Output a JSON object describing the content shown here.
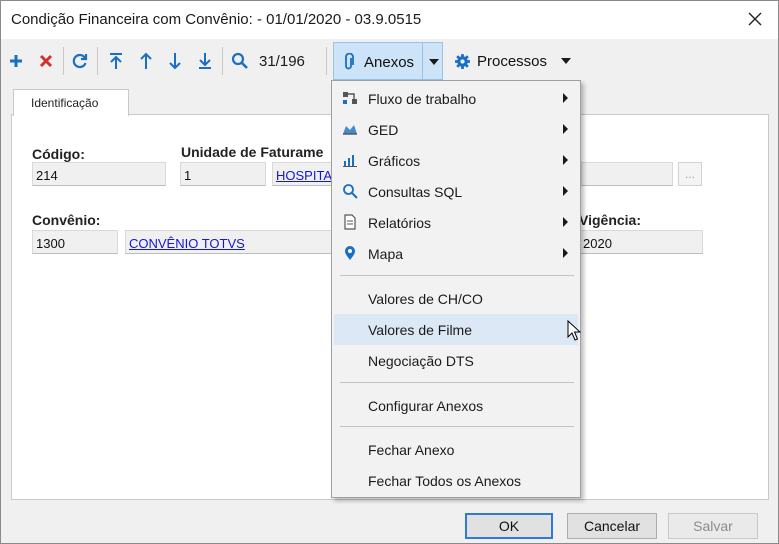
{
  "window": {
    "title": "Condição Financeira com Convênio:  - 01/01/2020 - 03.9.0515"
  },
  "toolbar": {
    "counter": "31/196",
    "anexos_label": "Anexos",
    "processos_label": "Processos",
    "icons": [
      "plus-icon",
      "delete-x-icon",
      "refresh-icon",
      "first-record-icon",
      "previous-record-icon",
      "next-record-icon",
      "last-record-icon",
      "search-icon",
      "paperclip-icon",
      "gear-icon",
      "chevron-down-icon"
    ]
  },
  "tab": {
    "label": "Identificação"
  },
  "form": {
    "codigo_label": "Código:",
    "codigo_value": "214",
    "unidade_label": "Unidade de Faturame",
    "unidade_value": "1",
    "unidade_link": "HOSPITA",
    "ellipsis": "...",
    "convenio_label": "Convênio:",
    "convenio_value": "1300",
    "convenio_link": "CONVÊNIO TOTVS",
    "vigencia_label": "Vigência:",
    "vigencia_value": "2020"
  },
  "menu": {
    "items": [
      {
        "label": "Fluxo de trabalho",
        "icon": "workflow-icon",
        "submenu": true
      },
      {
        "label": "GED",
        "icon": "ged-icon",
        "submenu": true
      },
      {
        "label": "Gráficos",
        "icon": "chart-icon",
        "submenu": true
      },
      {
        "label": "Consultas SQL",
        "icon": "search-icon",
        "submenu": true
      },
      {
        "label": "Relatórios",
        "icon": "report-icon",
        "submenu": true
      },
      {
        "label": "Mapa",
        "icon": "map-pin-icon",
        "submenu": true
      },
      {
        "label": "Valores de CH/CO",
        "submenu": false
      },
      {
        "label": "Valores de Filme",
        "submenu": false,
        "highlighted": true
      },
      {
        "label": "Negociação DTS",
        "submenu": false
      },
      {
        "label": "Configurar Anexos",
        "submenu": false
      },
      {
        "label": "Fechar Anexo",
        "submenu": false
      },
      {
        "label": "Fechar Todos os Anexos",
        "submenu": false
      }
    ]
  },
  "buttons": {
    "ok": "OK",
    "cancel": "Cancelar",
    "save": "Salvar"
  },
  "colors": {
    "accent": "#1a6fc4",
    "delete": "#d32f2f",
    "link": "#1515d6",
    "highlight": "#dce8f6"
  }
}
